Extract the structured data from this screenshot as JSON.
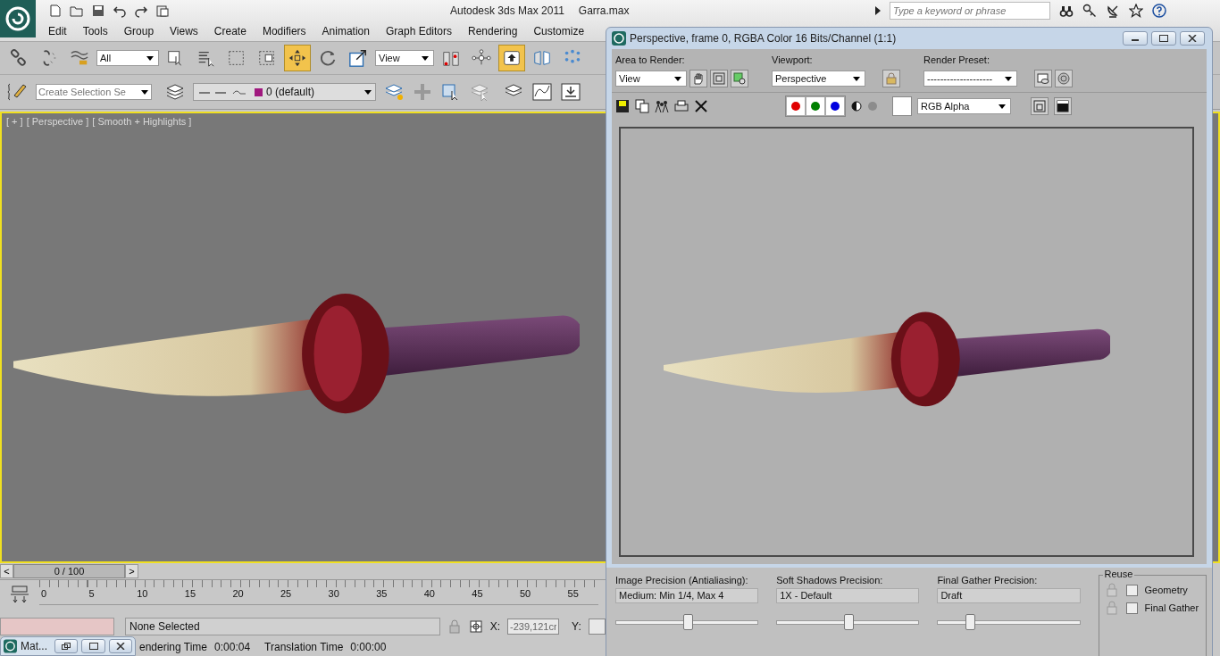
{
  "app": {
    "title": "Autodesk 3ds Max  2011",
    "file": "Garra.max"
  },
  "search": {
    "placeholder": "Type a keyword or phrase"
  },
  "menu": [
    "Edit",
    "Tools",
    "Group",
    "Views",
    "Create",
    "Modifiers",
    "Animation",
    "Graph Editors",
    "Rendering",
    "Customize"
  ],
  "main_toolbar": [
    {
      "kind": "link",
      "on": false
    },
    {
      "kind": "unlink",
      "on": false
    },
    {
      "kind": "bind",
      "on": false
    },
    {
      "kind": "filter",
      "value": "All"
    },
    {
      "kind": "select",
      "on": false
    },
    {
      "kind": "select-by-name",
      "on": false
    },
    {
      "kind": "region",
      "on": false
    },
    {
      "kind": "window",
      "on": false
    },
    {
      "kind": "move",
      "on": true
    },
    {
      "kind": "rotate",
      "on": false
    },
    {
      "kind": "scale",
      "on": false
    },
    {
      "kind": "coord",
      "value": "View"
    },
    {
      "kind": "pivot",
      "on": false
    },
    {
      "kind": "manipulate",
      "on": false
    },
    {
      "kind": "shortcut",
      "on": true
    },
    {
      "kind": "mirror",
      "on": false
    },
    {
      "kind": "array",
      "on": false
    }
  ],
  "second_toolbar": {
    "selection_set": {
      "placeholder": "Create Selection Se"
    },
    "layer": {
      "name": "0 (default)",
      "color": "#a0187e"
    }
  },
  "viewport": {
    "active": true,
    "labels": [
      "[ + ]",
      "[ Perspective ]",
      "[ Smooth + Highlights ]"
    ]
  },
  "timeline": {
    "prev": "<",
    "position": "0 / 100",
    "next": ">",
    "level": 0,
    "ticks": [
      "0",
      "5",
      "10",
      "15",
      "20",
      "25",
      "30",
      "35",
      "40",
      "45",
      "50",
      "55"
    ]
  },
  "status": {
    "selection": "None Selected",
    "x_label": "X:",
    "x_value": "-239,121cr",
    "y_label": "Y:",
    "render_time_label": "endering Time",
    "render_time": "0:00:04",
    "translation_label": "Translation Time",
    "translation_time": "0:00:00"
  },
  "mini_window": {
    "title": "Mat..."
  },
  "render_window": {
    "title": "Perspective, frame 0, RGBA Color 16 Bits/Channel (1:1)",
    "area_to_render": {
      "label": "Area to Render:",
      "value": "View"
    },
    "viewport": {
      "label": "Viewport:",
      "value": "Perspective"
    },
    "render_preset": {
      "label": "Render Preset:",
      "value": "--------------------"
    },
    "channels": [
      {
        "color": "#e00000",
        "on": true
      },
      {
        "color": "#008000",
        "on": true
      },
      {
        "color": "#0000e0",
        "on": true
      }
    ],
    "display": "RGB Alpha",
    "precision": [
      {
        "label": "Image Precision (Antialiasing):",
        "value": "Medium: Min 1/4, Max 4",
        "level": 0.5
      },
      {
        "label": "Soft Shadows Precision:",
        "value": "1X - Default",
        "level": 0.5
      },
      {
        "label": "Final Gather Precision:",
        "value": "Draft",
        "level": 0.22
      }
    ],
    "reuse": {
      "label": "Reuse",
      "options": [
        {
          "label": "Geometry",
          "checked": false
        },
        {
          "label": "Final Gather",
          "checked": false
        }
      ]
    }
  }
}
